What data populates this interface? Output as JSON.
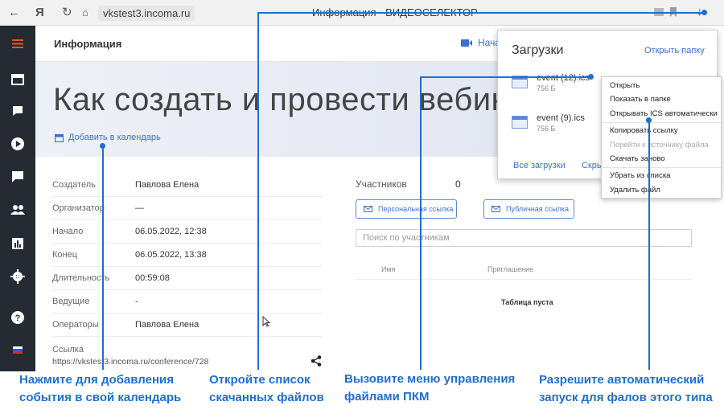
{
  "browser": {
    "url": "vkstest3.incoma.ru",
    "title": "Информация - ВИДЕОСЕЛЕКТОР",
    "back_icon": "←",
    "yandex_icon": "Я",
    "reload_icon": "↻",
    "lock_icon": "⌂",
    "download_icon": "↓"
  },
  "header": {
    "title": "Информация",
    "start_button": "Нача"
  },
  "banner": {
    "title": "Как создать и провести вебинар",
    "add_calendar": "Добавить в календарь"
  },
  "info": [
    {
      "label": "Создатель",
      "value": "Павлова Елена"
    },
    {
      "label": "Организатор",
      "value": "—"
    },
    {
      "label": "Начало",
      "value": "06.05.2022, 12:38"
    },
    {
      "label": "Конец",
      "value": "06.05.2022, 13:38"
    },
    {
      "label": "Длительность",
      "value": "00:59:08"
    },
    {
      "label": "Ведущие",
      "value": "-"
    },
    {
      "label": "Операторы",
      "value": "Павлова Елена"
    }
  ],
  "link": {
    "label": "Ссылка",
    "value": "https://vkstest3.incoma.ru/conference/728"
  },
  "participants": {
    "label": "Участников",
    "count": "0",
    "personal_link": "Персональная ссылка",
    "public_link": "Публичная ссылка",
    "search_placeholder": "Поиск по участникам",
    "col_name": "Имя",
    "col_invite": "Приглашение",
    "empty": "Таблица пуста"
  },
  "downloads": {
    "title": "Загрузки",
    "open_folder": "Открыть папку",
    "files": [
      {
        "name": "event (12).ics",
        "size": "756 Б"
      },
      {
        "name": "event (9).ics",
        "size": "756 Б"
      }
    ],
    "all_downloads": "Все загрузки",
    "hide": "Скры"
  },
  "context_menu": {
    "items": [
      {
        "label": "Открыть",
        "disabled": false
      },
      {
        "label": "Показать в папке",
        "disabled": false
      },
      {
        "label": "Открывать ICS автоматически",
        "disabled": false
      },
      {
        "label": "Копировать ссылку",
        "disabled": false
      },
      {
        "label": "Перейти к источнику файла",
        "disabled": true
      },
      {
        "label": "Скачать заново",
        "disabled": false
      },
      {
        "label": "Убрать из списка",
        "disabled": false
      },
      {
        "label": "Удалить файл",
        "disabled": false
      }
    ]
  },
  "callouts": {
    "c1_line1": "Нажмите для добавления",
    "c1_line2": "события в свой календарь",
    "c2_line1": "Откройте список",
    "c2_line2": "скачанных файлов",
    "c3_line1": "Вызовите меню управления",
    "c3_line2": "файлами ПКМ",
    "c4_line1": "Разрешите автоматический",
    "c4_line2": "запуск для фалов этого типа"
  },
  "colors": {
    "accent": "#3c6fcf",
    "callout": "#1f6fd1",
    "sidebar": "#262b33"
  }
}
